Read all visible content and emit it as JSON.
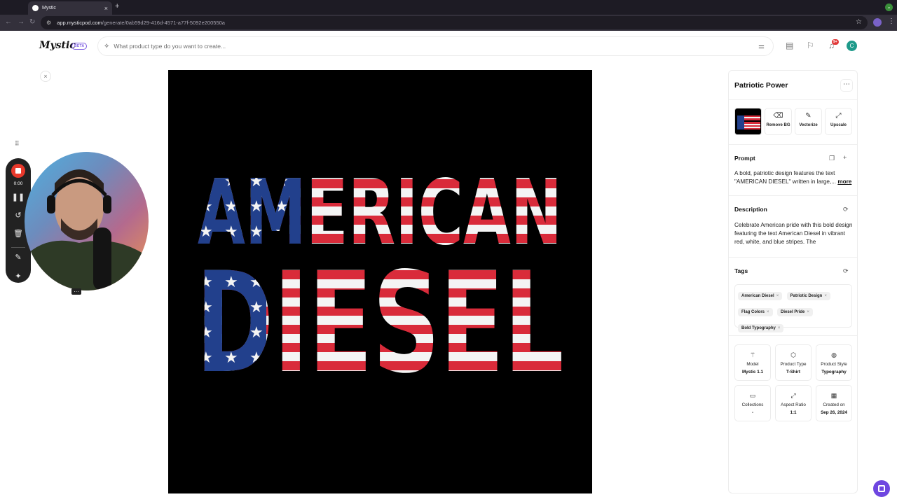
{
  "browser": {
    "tab_title": "Mystic",
    "url_host": "app.mysticpod.com",
    "url_path": "/generate/0ab59d29-416d-4571-a77f-5092e200550a"
  },
  "header": {
    "logo": "Mystic",
    "beta": "BETA",
    "search_placeholder": "What product type do you want to create...",
    "notif_count": "9+",
    "avatar_initial": "C"
  },
  "canvas": {
    "line1": "AMERICAN",
    "line2": "DIESEL"
  },
  "recorder": {
    "time": "0:00"
  },
  "panel": {
    "title": "Patriotic Power",
    "tools": [
      {
        "label": "Remove BG",
        "icon": "eraser-icon"
      },
      {
        "label": "Vectorize",
        "icon": "pen-icon"
      },
      {
        "label": "Upscale",
        "icon": "upscale-icon"
      }
    ],
    "prompt": {
      "title": "Prompt",
      "text": "A bold, patriotic design features the text \"AMERICAN DIESEL\" written in large,...",
      "more": "more"
    },
    "description": {
      "title": "Description",
      "text": "Celebrate American pride with this bold design featuring the text American Diesel in vibrant red, white, and blue stripes. The"
    },
    "tags": {
      "title": "Tags",
      "items": [
        "American Diesel",
        "Patriotic Design",
        "Flag Colors",
        "Diesel Pride",
        "Bold Typography"
      ]
    },
    "meta": [
      {
        "label": "Model",
        "value": "Mystic 1.1",
        "icon": "wand-icon"
      },
      {
        "label": "Product Type",
        "value": "T-Shirt",
        "icon": "box-icon"
      },
      {
        "label": "Product Style",
        "value": "Typography",
        "icon": "palette-icon"
      },
      {
        "label": "Collections",
        "value": "-",
        "icon": "folder-icon"
      },
      {
        "label": "Aspect Ratio",
        "value": "1:1",
        "icon": "expand-icon"
      },
      {
        "label": "Created on",
        "value": "Sep 26, 2024",
        "icon": "calendar-icon"
      }
    ]
  },
  "colors": {
    "flag_red": "#d92b3a",
    "flag_blue": "#22408c",
    "brand_purple": "#6e46e0",
    "record_red": "#e8392c"
  }
}
